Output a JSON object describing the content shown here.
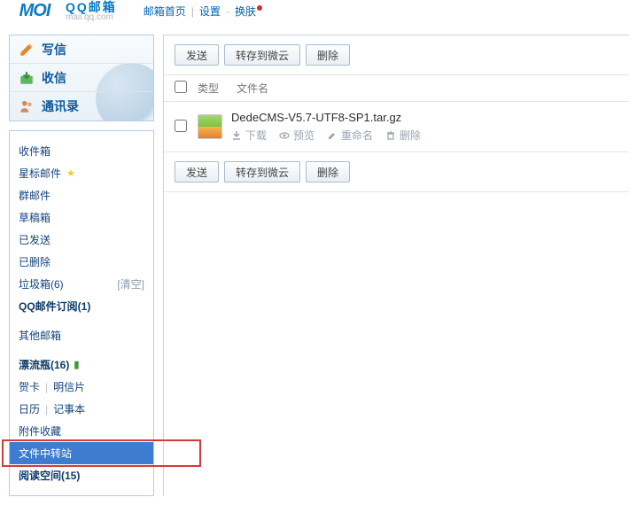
{
  "brand": {
    "logo_text": "MOI",
    "cn": "QQ邮箱",
    "en": "mail.qq.com"
  },
  "top_nav": {
    "home": "邮箱首页",
    "settings": "设置",
    "skin": "换肤"
  },
  "sidebar_main": {
    "compose": "写信",
    "receive": "收信",
    "contacts": "通讯录"
  },
  "folders": {
    "inbox": "收件箱",
    "starred": "星标邮件",
    "group": "群邮件",
    "drafts": "草稿箱",
    "sent": "已发送",
    "deleted": "已删除",
    "spam": "垃圾箱(6)",
    "spam_clear": "[清空]",
    "subscribe": "QQ邮件订阅(1)",
    "other": "其他邮箱",
    "drift": "漂流瓶(16)",
    "cards": "贺卡",
    "postcards": "明信片",
    "calendar": "日历",
    "notes": "记事本",
    "attachments": "附件收藏",
    "file_relay": "文件中转站",
    "read_space": "阅读空间(15)"
  },
  "toolbar": {
    "send": "发送",
    "to_weiyun": "转存到微云",
    "delete": "删除"
  },
  "table": {
    "col_type": "类型",
    "col_name": "文件名"
  },
  "file": {
    "name": "DedeCMS-V5.7-UTF8-SP1.tar.gz",
    "actions": {
      "download": "下载",
      "preview": "预览",
      "rename": "重命名",
      "delete": "删除"
    }
  }
}
